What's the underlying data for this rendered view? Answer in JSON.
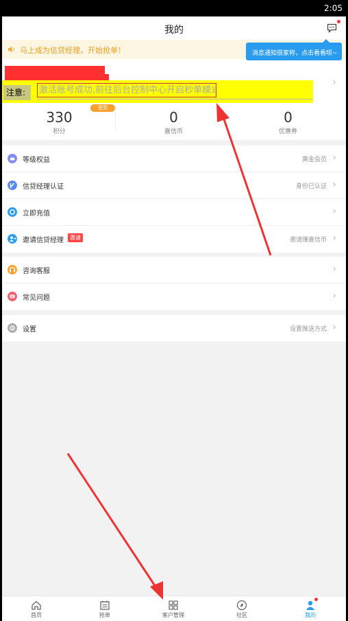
{
  "status_bar": {
    "time": "2:05"
  },
  "header": {
    "title": "我的"
  },
  "notice": {
    "text": "马上成为信贷经理，开始抢单！"
  },
  "tooltip": {
    "text": "消息通知很家称，点击看看呗~"
  },
  "highlight": {
    "label": "注意:",
    "message": "激活账号成功,前往后台控制中心开启秒单模式"
  },
  "stats": [
    {
      "value": "330",
      "label": "积分",
      "badge": "签到"
    },
    {
      "value": "0",
      "label": "嘉信币"
    },
    {
      "value": "0",
      "label": "优惠券"
    }
  ],
  "menu_group1": [
    {
      "label": "等级权益",
      "value": "黄金会员",
      "icon": "crown-icon",
      "color": "#7e8cf0"
    },
    {
      "label": "信贷经理认证",
      "value": "身份已认证",
      "icon": "verify-icon",
      "color": "#5a8af0"
    },
    {
      "label": "立即充值",
      "value": "",
      "icon": "recharge-icon",
      "color": "#2a9cf0"
    },
    {
      "label": "邀请信贷经理",
      "value": "邀请赚嘉信币",
      "badge": "邀请",
      "icon": "invite-icon",
      "color": "#2a9cf0"
    }
  ],
  "menu_group2": [
    {
      "label": "咨询客服",
      "value": "",
      "icon": "headset-icon",
      "color": "#f8a030"
    },
    {
      "label": "常见问题",
      "value": "",
      "icon": "faq-icon",
      "color": "#f06070"
    }
  ],
  "menu_group3": [
    {
      "label": "设置",
      "value": "设置推送方式",
      "icon": "settings-icon",
      "color": "#aaaaaa"
    }
  ],
  "tabs": [
    {
      "label": "首页",
      "icon": "home-icon"
    },
    {
      "label": "抢单",
      "icon": "calendar-icon"
    },
    {
      "label": "客户管理",
      "icon": "grid-icon"
    },
    {
      "label": "社区",
      "icon": "compass-icon"
    },
    {
      "label": "我的",
      "icon": "user-icon"
    }
  ],
  "colors": {
    "accent": "#2a9cf0",
    "highlight": "#ffff00",
    "arrow": "#ee3333",
    "badge": "#f8a030"
  }
}
